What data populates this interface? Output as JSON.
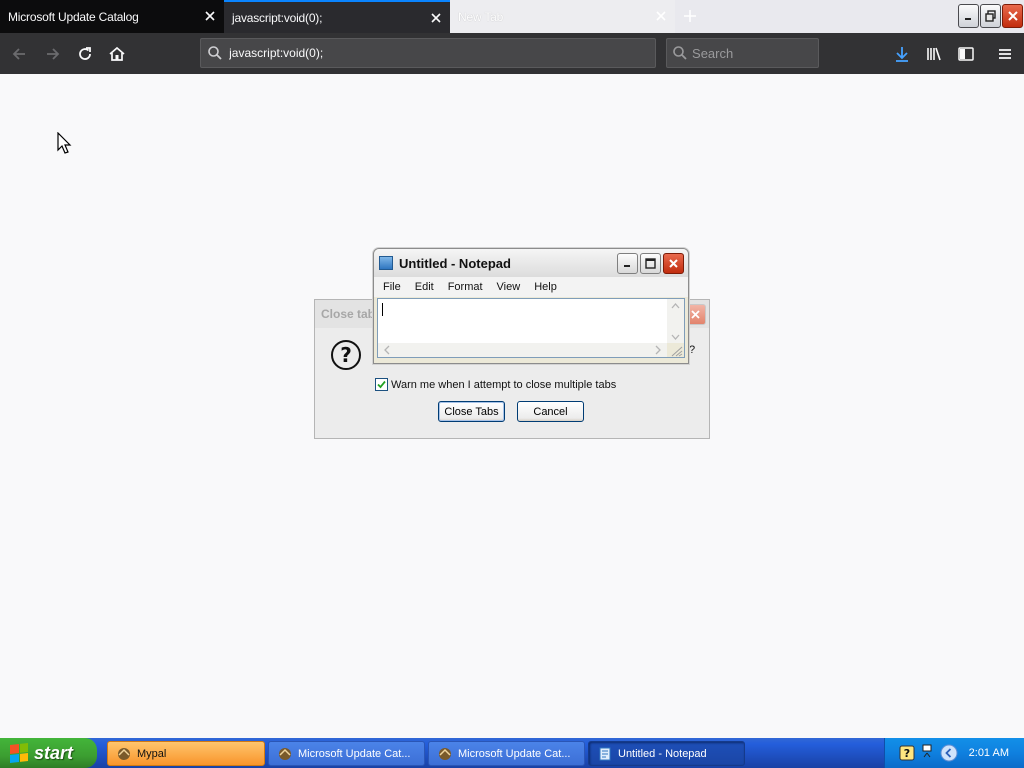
{
  "browser": {
    "tabs": [
      {
        "title": "Microsoft Update Catalog"
      },
      {
        "title": "javascript:void(0);"
      },
      {
        "title": "New Tab"
      }
    ],
    "url": "javascript:void(0);",
    "search_placeholder": "Search"
  },
  "dialog": {
    "title": "Close tab",
    "trailing_glyph": "?",
    "checkbox_label": "Warn me when I attempt to close multiple tabs",
    "checkbox_checked": true,
    "close_button": "Close Tabs",
    "cancel_button": "Cancel"
  },
  "notepad": {
    "title": "Untitled - Notepad",
    "menu": [
      "File",
      "Edit",
      "Format",
      "View",
      "Help"
    ],
    "text": ""
  },
  "taskbar": {
    "start_label": "start",
    "tasks": [
      {
        "label": "Mypal"
      },
      {
        "label": "Microsoft Update Cat..."
      },
      {
        "label": "Microsoft Update Cat..."
      },
      {
        "label": "Untitled - Notepad"
      }
    ],
    "clock": "2:01 AM"
  },
  "colors": {
    "accent": "#0a84ff",
    "taskbar": "#245edb",
    "start": "#3c9e31"
  }
}
